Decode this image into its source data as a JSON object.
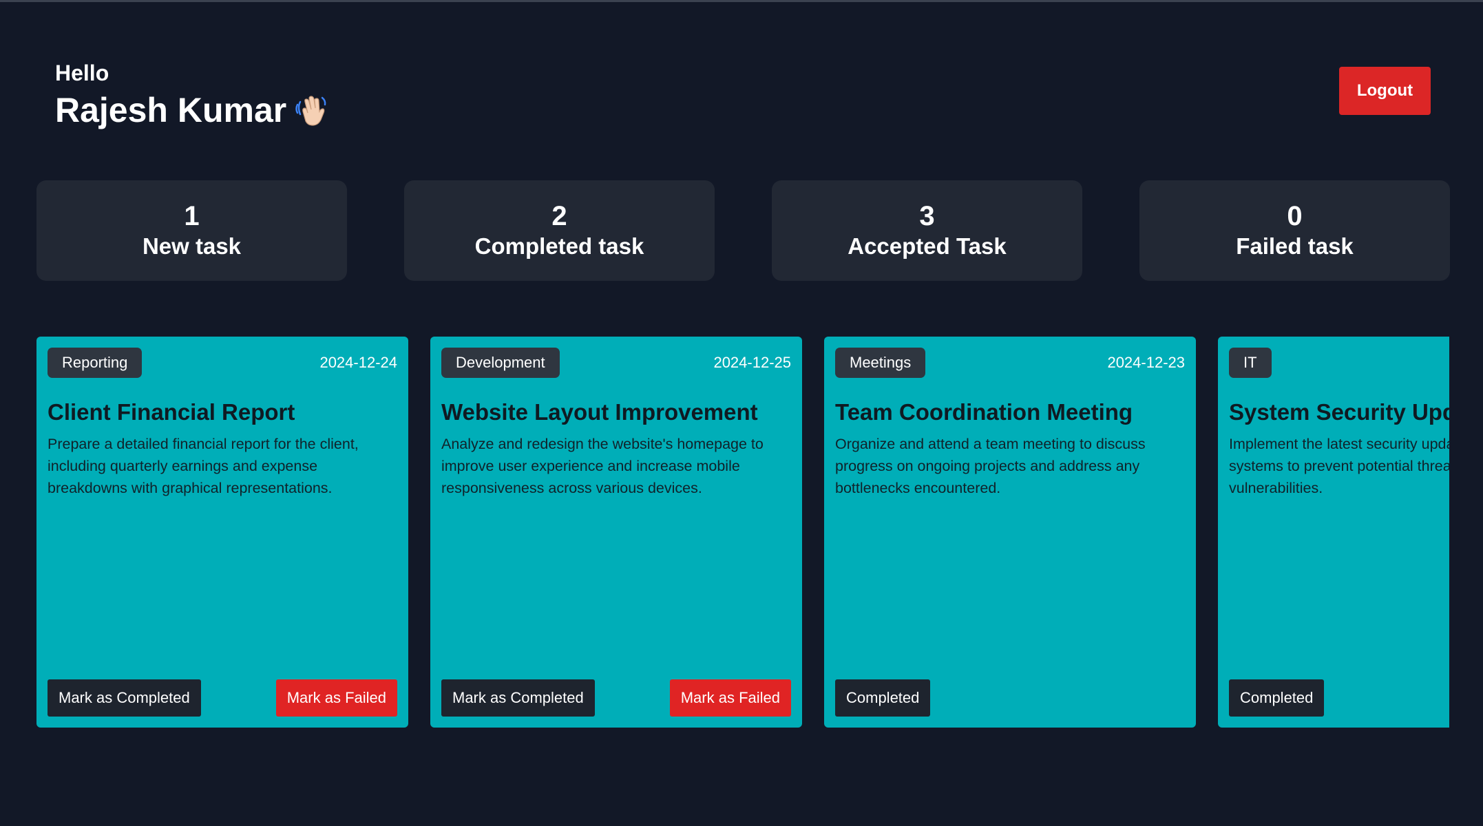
{
  "header": {
    "greeting": "Hello",
    "user_name": "Rajesh Kumar",
    "wave_icon": "waving-hand-icon",
    "logout_label": "Logout"
  },
  "colors": {
    "background": "#121827",
    "stat_card": "#222834",
    "task_card": "#00aeb8",
    "danger": "#dc2626",
    "dark_button": "#1e242e"
  },
  "stats": [
    {
      "count": "1",
      "label": "New task"
    },
    {
      "count": "2",
      "label": "Completed task"
    },
    {
      "count": "3",
      "label": "Accepted Task"
    },
    {
      "count": "0",
      "label": "Failed task"
    }
  ],
  "tasks": [
    {
      "category": "Reporting",
      "date": "2024-12-24",
      "title": "Client Financial Report",
      "description": "Prepare a detailed financial report for the client, including quarterly earnings and expense breakdowns with graphical representations.",
      "primary_action": "Mark as Completed",
      "secondary_action": "Mark as Failed"
    },
    {
      "category": "Development",
      "date": "2024-12-25",
      "title": "Website Layout Improvement",
      "description": "Analyze and redesign the website's homepage to improve user experience and increase mobile responsiveness across various devices.",
      "primary_action": "Mark as Completed",
      "secondary_action": "Mark as Failed"
    },
    {
      "category": "Meetings",
      "date": "2024-12-23",
      "title": "Team Coordination Meeting",
      "description": "Organize and attend a team meeting to discuss progress on ongoing projects and address any bottlenecks encountered.",
      "primary_action": "Completed"
    },
    {
      "category": "IT",
      "date": "",
      "title": "System Security Update",
      "description": "Implement the latest security updates on company systems to prevent potential threats and vulnerabilities.",
      "primary_action": "Completed"
    }
  ]
}
